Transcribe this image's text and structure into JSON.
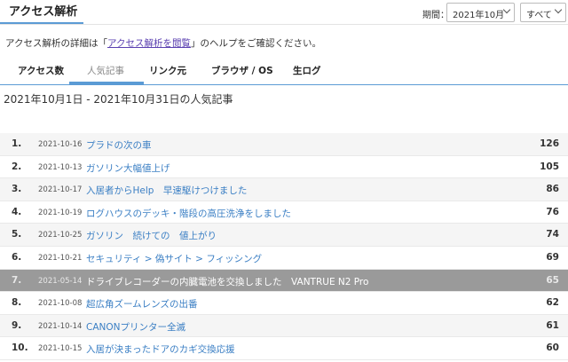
{
  "header": {
    "title": "アクセス解析",
    "period_label": "期間：",
    "month_select": "2021年10月",
    "filter_select": "すべて"
  },
  "help": {
    "prefix": "アクセス解析の詳細は「",
    "link": "アクセス解析を閲覧",
    "suffix": "」のヘルプをご確認ください。"
  },
  "tabs": [
    {
      "label": "アクセス数"
    },
    {
      "label": "人気記事"
    },
    {
      "label": "リンク元"
    },
    {
      "label": "ブラウザ / OS"
    },
    {
      "label": "生ログ"
    }
  ],
  "active_tab": "人気記事",
  "range_title": "2021年10月1日 - 2021年10月31日の人気記事",
  "rows": [
    {
      "rank": "1.",
      "date": "2021-10-16",
      "title": "プラドの次の車",
      "views": "126"
    },
    {
      "rank": "2.",
      "date": "2021-10-13",
      "title": "ガソリン大幅値上げ",
      "views": "105"
    },
    {
      "rank": "3.",
      "date": "2021-10-17",
      "title": "入居者からHelp　早速駆けつけました",
      "views": "86"
    },
    {
      "rank": "4.",
      "date": "2021-10-19",
      "title": "ログハウスのデッキ・階段の高圧洗浄をしました",
      "views": "76"
    },
    {
      "rank": "5.",
      "date": "2021-10-25",
      "title": "ガソリン　続けての　値上がり",
      "views": "74"
    },
    {
      "rank": "6.",
      "date": "2021-10-21",
      "title": "セキュリティ > 偽サイト > フィッシング",
      "views": "69"
    },
    {
      "rank": "7.",
      "date": "2021-05-14",
      "title": "ドライブレコーダーの内臓電池を交換しました　VANTRUE N2 Pro",
      "views": "65"
    },
    {
      "rank": "8.",
      "date": "2021-10-08",
      "title": "超広角ズームレンズの出番",
      "views": "62"
    },
    {
      "rank": "9.",
      "date": "2021-10-14",
      "title": "CANONプリンター全滅",
      "views": "61"
    },
    {
      "rank": "10.",
      "date": "2021-10-15",
      "title": "入居が決まったドアのカギ交換応援",
      "views": "60"
    }
  ]
}
